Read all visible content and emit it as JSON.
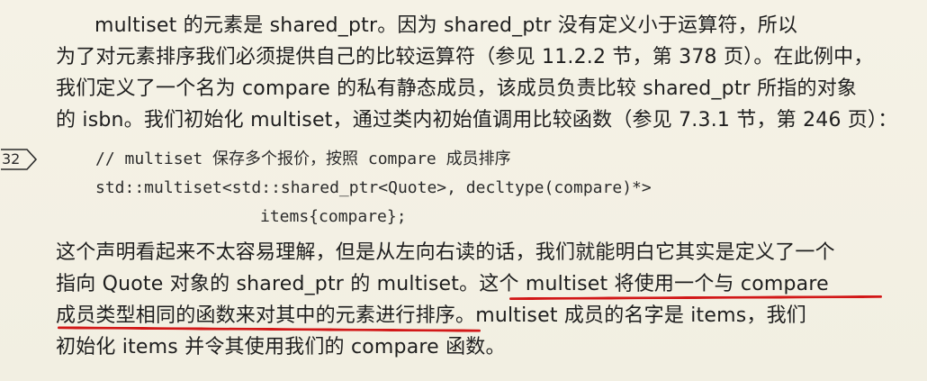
{
  "paragraph1": {
    "line1": "multiset 的元素是 shared_ptr。因为 shared_ptr 没有定义小于运算符，所以",
    "line2": "为了对元素排序我们必须提供自己的比较运算符（参见 11.2.2 节，第 378 页）。在此例中，",
    "line3": "我们定义了一个名为 compare 的私有静态成员，该成员负责比较 shared_ptr 所指的对象",
    "line4": "的 isbn。我们初始化 multiset，通过类内初始值调用比较函数（参见 7.3.1 节，第 246 页）："
  },
  "page_marker": "32",
  "code": {
    "line1": "// multiset 保存多个报价，按照 compare 成员排序",
    "line2": "std::multiset<std::shared_ptr<Quote>, decltype(compare)*>",
    "line3": "items{compare};"
  },
  "paragraph2": {
    "line1": "这个声明看起来不太容易理解，但是从左向右读的话，我们就能明白它其实是定义了一个",
    "line2_a": "指向 Quote 对象的 shared_ptr 的 multiset。",
    "line2_b": "这个 multiset 将使用一个与 compare",
    "line3_a": "成员类型相同的函数来对其中的元素进行排序。",
    "line3_b": "multiset 成员的名字是 items，我们",
    "line4": "初始化 items 并令其使用我们的 compare 函数。"
  },
  "annotation": {
    "underline_color": "#d21818"
  }
}
